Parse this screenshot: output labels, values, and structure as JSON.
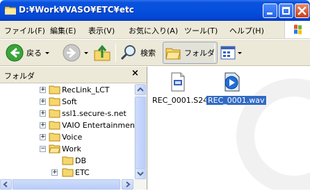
{
  "window": {
    "title": "D:¥Work¥VASO¥ETC¥etc"
  },
  "menu": [
    "ファイル(F)",
    "編集(E)",
    "表示(V)",
    "お気に入り(A)",
    "ツール(T)",
    "ヘルプ(H)"
  ],
  "toolbar": {
    "back_label": "戻る",
    "search_label": "検索",
    "folders_label": "フォルダ"
  },
  "left_pane": {
    "title": "フォルダ",
    "close_glyph": "×",
    "tree": [
      {
        "label": "RecLink_LCT",
        "expander": "+"
      },
      {
        "label": "Soft",
        "expander": "+"
      },
      {
        "label": "ssl1.secure-s.net",
        "expander": "+"
      },
      {
        "label": "VAIO Entertainment",
        "expander": "+"
      },
      {
        "label": "Voice",
        "expander": "+"
      },
      {
        "label": "Work",
        "expander": "−"
      },
      {
        "label": "DB",
        "expander": ""
      },
      {
        "label": "ETC",
        "expander": "+"
      }
    ]
  },
  "files": [
    {
      "name": "REC_0001.S24",
      "icon": "generic-file-icon",
      "selected": false
    },
    {
      "name": "REC_0001.wav",
      "icon": "media-player-file-icon",
      "selected": true
    }
  ]
}
